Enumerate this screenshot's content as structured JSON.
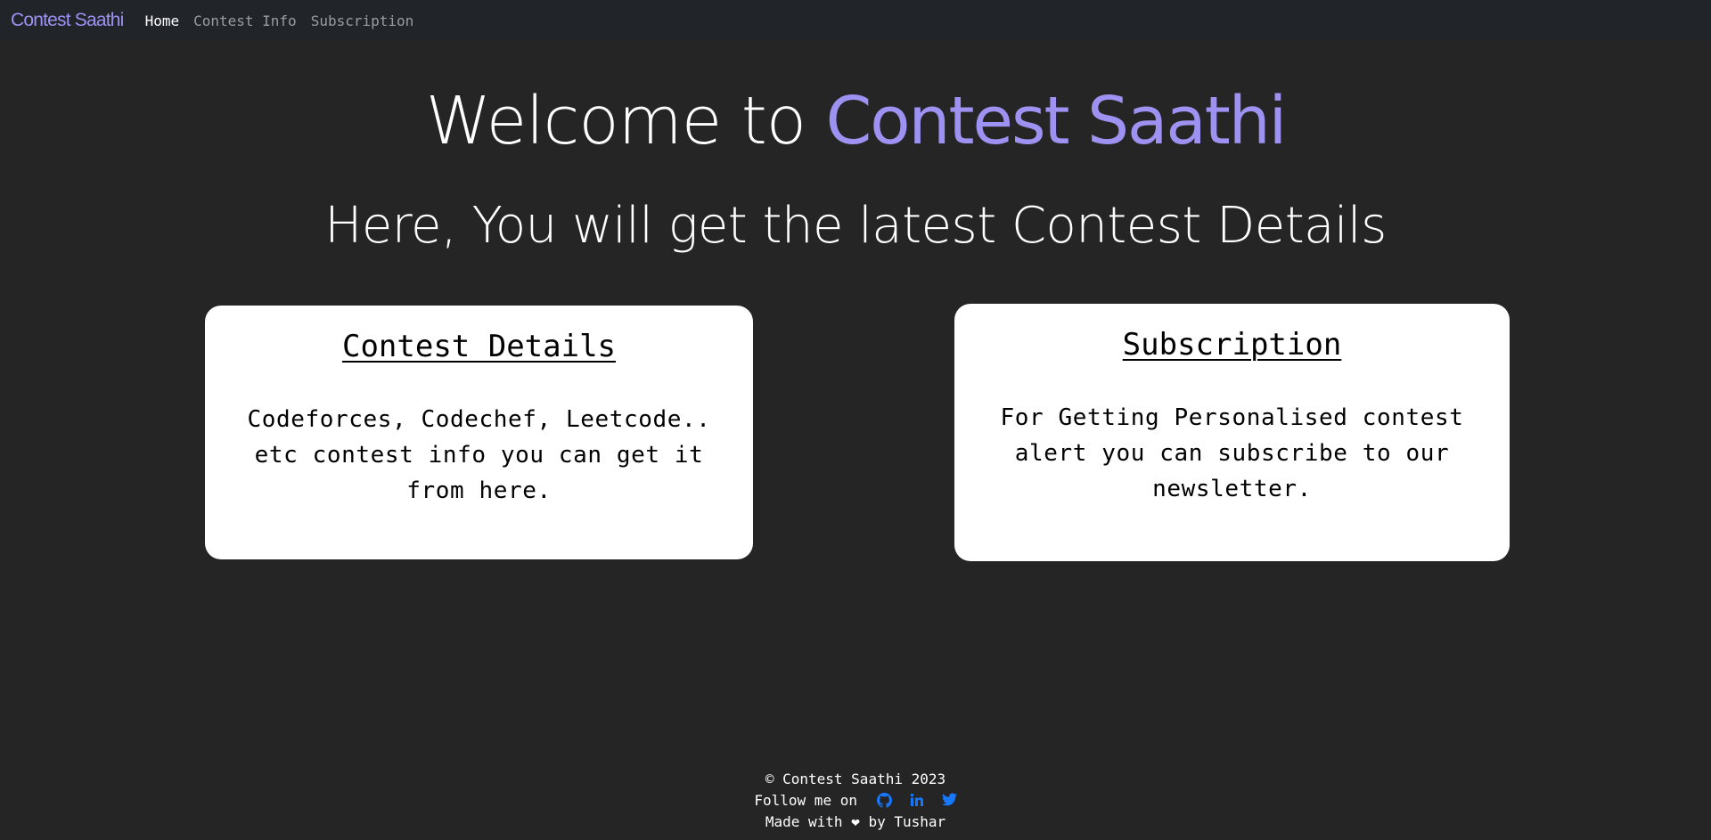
{
  "navbar": {
    "brand": "Contest Saathi",
    "links": [
      {
        "label": "Home",
        "active": true
      },
      {
        "label": "Contest Info",
        "active": false
      },
      {
        "label": "Subscription",
        "active": false
      }
    ]
  },
  "hero": {
    "title_prefix": "Welcome to ",
    "title_accent": "Contest Saathi",
    "subtitle": "Here, You will get the latest Contest Details"
  },
  "cards": [
    {
      "title": "Contest Details",
      "text": "Codeforces, Codechef, Leetcode.. etc contest info you can get it from here."
    },
    {
      "title": "Subscription",
      "text": "For Getting Personalised contest alert you can subscribe to our newsletter."
    }
  ],
  "footer": {
    "copyright": "© Contest Saathi 2023",
    "follow": "Follow me on",
    "made_with": "Made with ❤ by Tushar",
    "social_icons": [
      "github-icon",
      "linkedin-icon",
      "twitter-icon"
    ]
  },
  "colors": {
    "accent": "#9d92f1",
    "background": "#252525",
    "navbar": "#212429",
    "social": "#1677ff"
  }
}
